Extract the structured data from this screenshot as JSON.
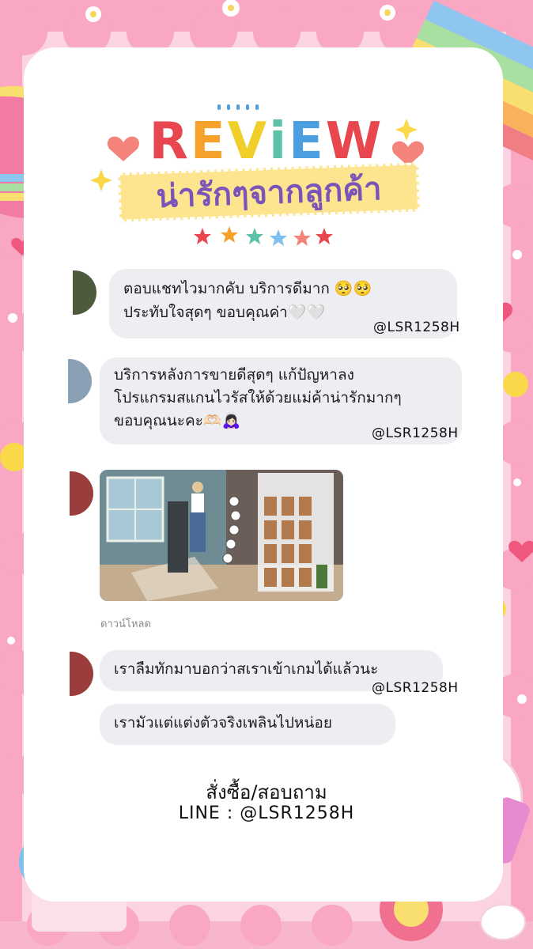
{
  "header": {
    "title_letters": [
      {
        "char": "R",
        "color": "#e8474f"
      },
      {
        "char": "E",
        "color": "#f5a12b"
      },
      {
        "char": "V",
        "color": "#f1cf2a"
      },
      {
        "char": "i",
        "color": "#5bc1a7"
      },
      {
        "char": "E",
        "color": "#4b9fe0"
      },
      {
        "char": "W",
        "color": "#e8474f"
      }
    ],
    "subtitle": "น่ารักๆจากลูกค้า"
  },
  "reviews": [
    {
      "text": "ตอบแชทไวมากคับ บริการดีมาก 🥺🥺\nประทับใจสุดๆ ขอบคุณค่า🤍🤍",
      "handle": "@LSR1258H"
    },
    {
      "text": "บริการหลังการขายดีสุดๆ แก้ปัญหาลง\nโปรแกรมสแกนไวรัสให้ด้วยแม่ค้าน่ารักมากๆ\nขอบคุณนะคะ🫶🏻🙇🏻‍♀️",
      "handle": "@LSR1258H"
    },
    {
      "download_label": "ดาวน์โหลด"
    },
    {
      "text": "เราลืมทักมาบอกว่าสเราเข้าเกมได้แล้วนะ",
      "handle": "@LSR1258H"
    },
    {
      "text": "เรามัวแต่แต่งตัวจริงเพลินไปหน่อย"
    }
  ],
  "footer": {
    "order_label": "สั่งซื้อ/สอบถาม",
    "line_contact": "LINE : @LSR1258H"
  },
  "colors": {
    "background_pink": "#fbd3e3",
    "bubble_gray": "#eceef2",
    "subtitle_purple": "#7a54b8",
    "ribbon_yellow": "#fde48f"
  }
}
